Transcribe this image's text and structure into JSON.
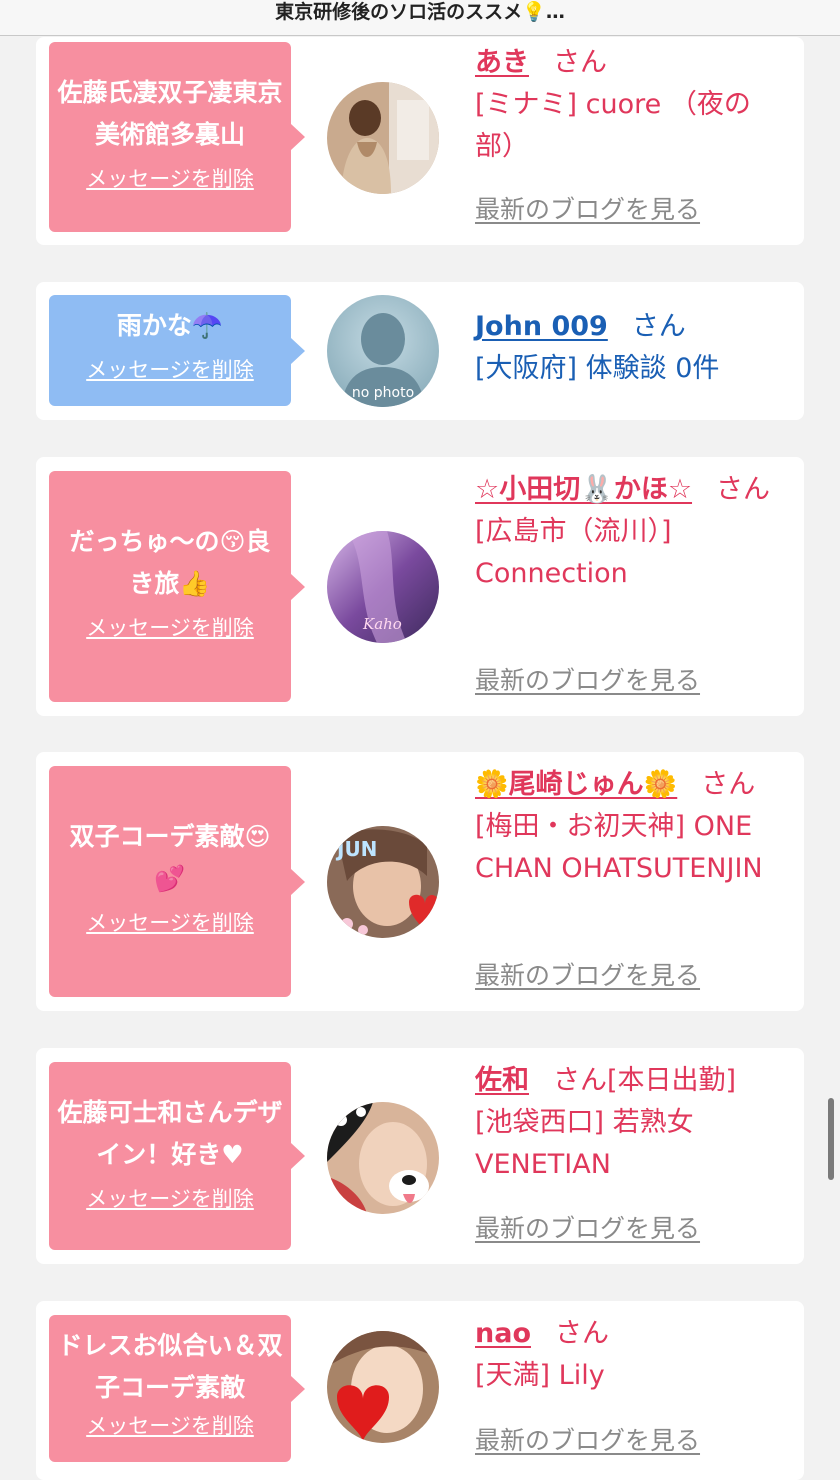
{
  "header": {
    "title": "東京研修後のソロ活のススメ💡…"
  },
  "cards": [
    {
      "message": "佐藤氏凄双子凄東京美術館多裏山",
      "delete_label": "メッセージを削除",
      "name": "あき",
      "honorific": "さん",
      "detail": "[ミナミ] cuore （夜の部）",
      "blog_link": "最新のブログを見る"
    },
    {
      "message": "雨かな☂️",
      "delete_label": "メッセージを削除",
      "name": "John 009",
      "honorific": "さん",
      "detail": "[大阪府] 体験談 0件",
      "avatar_text": "no photo"
    },
    {
      "message": "だっちゅ〜の😚良き旅👍",
      "delete_label": "メッセージを削除",
      "name": "☆小田切🐰かほ☆",
      "honorific": "さん",
      "detail": "[広島市（流川）] Connection",
      "blog_link": "最新のブログを見る",
      "avatar_text": "Kaho"
    },
    {
      "message": "双子コーデ素敵😍💕",
      "delete_label": "メッセージを削除",
      "name": "🌼尾崎じゅん🌼",
      "honorific": "さん",
      "detail": "[梅田・お初天神] ONE CHAN OHATSUTENJIN",
      "blog_link": "最新のブログを見る",
      "avatar_text": "JUN"
    },
    {
      "message": "佐藤可士和さんデザイン！好き♥",
      "delete_label": "メッセージを削除",
      "name": "佐和",
      "honorific": "さん[本日出勤]",
      "detail": "[池袋西口] 若熟女VENETIAN",
      "blog_link": "最新のブログを見る"
    },
    {
      "message": "ドレスお似合い＆双子コーデ素敵",
      "delete_label": "メッセージを削除",
      "name": "nao",
      "honorific": "さん",
      "detail": "[天満] Lily",
      "blog_link": "最新のブログを見る"
    }
  ],
  "colors": {
    "pink_bubble": "#f78fa0",
    "blue_bubble": "#8fbcf3",
    "name_pink": "#e0375b",
    "name_blue": "#1a5fb4"
  }
}
